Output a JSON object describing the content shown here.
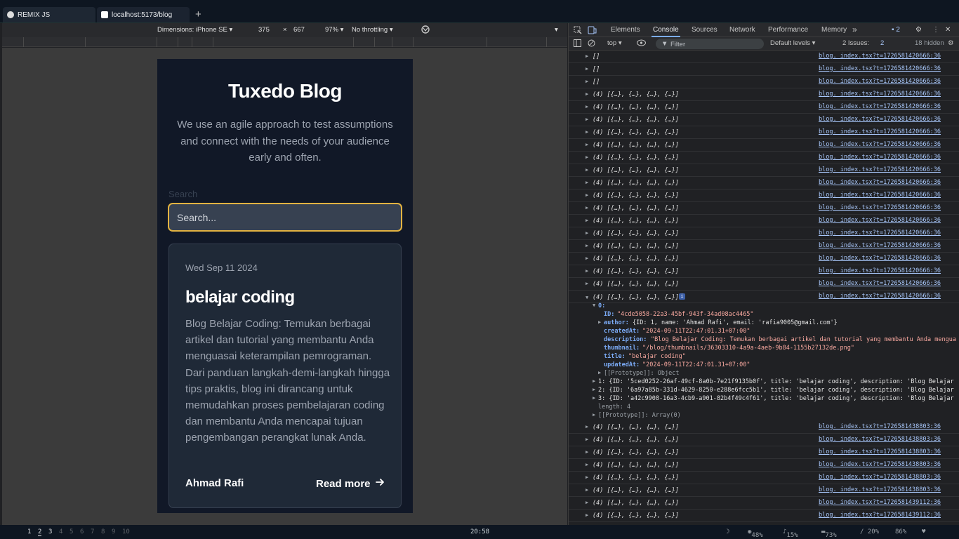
{
  "browser": {
    "tabs": [
      {
        "label": "REMIX JS"
      },
      {
        "label": "localhost:5173/blog"
      }
    ],
    "new_tab": "+"
  },
  "device_toolbar": {
    "dimensions_label": "Dimensions: iPhone SE ▾",
    "width": "375",
    "times": "×",
    "height": "667",
    "zoom": "97% ▾",
    "throttling": "No throttling ▾"
  },
  "blog": {
    "title": "Tuxedo Blog",
    "subtitle": "We use an agile approach to test assumptions and connect with the needs of your audience early and often.",
    "search_label": "Search",
    "search_placeholder": "Search...",
    "post": {
      "date": "Wed Sep 11 2024",
      "title": "belajar coding",
      "description": "Blog Belajar Coding: Temukan berbagai artikel dan tutorial yang membantu Anda menguasai keterampilan pemrograman. Dari panduan langkah-demi-langkah hingga tips praktis, blog ini dirancang untuk memudahkan proses pembelajaran coding dan membantu Anda mencapai tujuan pengembangan perangkat lunak Anda.",
      "author": "Ahmad Rafi",
      "read_more": "Read more"
    }
  },
  "devtools": {
    "tabs": [
      "Elements",
      "Console",
      "Sources",
      "Network",
      "Performance",
      "Memory"
    ],
    "more_tabs": "»",
    "issues_badge": "2",
    "context": "top ▾",
    "filter_placeholder": "Filter",
    "levels": "Default levels ▾",
    "issues_label": "2 Issues:",
    "issues_count": "2",
    "hidden": "18 hidden",
    "rows_top": [
      {
        "msg": "[]",
        "src": "blog._index.tsx?t=1726581420666:36"
      },
      {
        "msg": "[]",
        "src": "blog._index.tsx?t=1726581420666:36"
      },
      {
        "msg": "[]",
        "src": "blog._index.tsx?t=1726581420666:36"
      },
      {
        "msg": "(4) [{…}, {…}, {…}, {…}]",
        "src": "blog._index.tsx?t=1726581420666:36"
      },
      {
        "msg": "(4) [{…}, {…}, {…}, {…}]",
        "src": "blog._index.tsx?t=1726581420666:36"
      },
      {
        "msg": "(4) [{…}, {…}, {…}, {…}]",
        "src": "blog._index.tsx?t=1726581420666:36"
      },
      {
        "msg": "(4) [{…}, {…}, {…}, {…}]",
        "src": "blog._index.tsx?t=1726581420666:36"
      },
      {
        "msg": "(4) [{…}, {…}, {…}, {…}]",
        "src": "blog._index.tsx?t=1726581420666:36"
      },
      {
        "msg": "(4) [{…}, {…}, {…}, {…}]",
        "src": "blog._index.tsx?t=1726581420666:36"
      },
      {
        "msg": "(4) [{…}, {…}, {…}, {…}]",
        "src": "blog._index.tsx?t=1726581420666:36"
      },
      {
        "msg": "(4) [{…}, {…}, {…}, {…}]",
        "src": "blog._index.tsx?t=1726581420666:36"
      },
      {
        "msg": "(4) [{…}, {…}, {…}, {…}]",
        "src": "blog._index.tsx?t=1726581420666:36"
      },
      {
        "msg": "(4) [{…}, {…}, {…}, {…}]",
        "src": "blog._index.tsx?t=1726581420666:36"
      },
      {
        "msg": "(4) [{…}, {…}, {…}, {…}]",
        "src": "blog._index.tsx?t=1726581420666:36"
      },
      {
        "msg": "(4) [{…}, {…}, {…}, {…}]",
        "src": "blog._index.tsx?t=1726581420666:36"
      },
      {
        "msg": "(4) [{…}, {…}, {…}, {…}]",
        "src": "blog._index.tsx?t=1726581420666:36"
      },
      {
        "msg": "(4) [{…}, {…}, {…}, {…}]",
        "src": "blog._index.tsx?t=1726581420666:36"
      },
      {
        "msg": "(4) [{…}, {…}, {…}, {…}]",
        "src": "blog._index.tsx?t=1726581420666:36"
      },
      {
        "msg": "(4) [{…}, {…}, {…}, {…}]",
        "src": "blog._index.tsx?t=1726581420666:36"
      },
      {
        "msg": "",
        "src": "blog._index.tsx?t=1726581420666:36"
      }
    ],
    "expanded": {
      "header": "(4) [{…}, {…}, {…}, {…}]",
      "index0": "0:",
      "id_key": "ID:",
      "id_val": "\"4cde5058-22a3-45bf-943f-34ad08ac4465\"",
      "author_key": "author:",
      "author_val": "{ID: 1, name: 'Ahmad Rafi', email: 'rafia9005@gmail.com'}",
      "created_key": "createdAt:",
      "created_val": "\"2024-09-11T22:47:01.31+07:00\"",
      "desc_key": "description:",
      "desc_val": "\"Blog Belajar Coding: Temukan berbagai artikel dan tutorial yang membantu Anda mengua",
      "thumb_key": "thumbnail:",
      "thumb_val": "\"/blog/thumbnails/36303310-4a9a-4aeb-9b84-1155b27132de.png\"",
      "title_key": "title:",
      "title_val": "\"belajar coding\"",
      "updated_key": "updatedAt:",
      "updated_val": "\"2024-09-11T22:47:01.31+07:00\"",
      "proto_obj": "[[Prototype]]: Object",
      "item1": "1: {ID: '5ced0252-26af-49cf-8a0b-7e21f9135b0f', title: 'belajar coding', description: 'Blog Belajar",
      "item2": "2: {ID: '6a97a85b-331d-4629-8250-e288e6fcc5b1', title: 'belajar coding', description: 'Blog Belajar",
      "item3": "3: {ID: 'a42c9908-16a3-4cb9-a901-82b4f49c4f61', title: 'belajar coding', description: 'Blog Belajar",
      "length": "length: 4",
      "proto_arr": "[[Prototype]]: Array(0)"
    },
    "rows_bottom": [
      {
        "msg": "(4) [{…}, {…}, {…}, {…}]",
        "src": "blog._index.tsx?t=1726581438803:36"
      },
      {
        "msg": "(4) [{…}, {…}, {…}, {…}]",
        "src": "blog._index.tsx?t=1726581438803:36"
      },
      {
        "msg": "(4) [{…}, {…}, {…}, {…}]",
        "src": "blog._index.tsx?t=1726581438803:36"
      },
      {
        "msg": "(4) [{…}, {…}, {…}, {…}]",
        "src": "blog._index.tsx?t=1726581438803:36"
      },
      {
        "msg": "(4) [{…}, {…}, {…}, {…}]",
        "src": "blog._index.tsx?t=1726581438803:36"
      },
      {
        "msg": "(4) [{…}, {…}, {…}, {…}]",
        "src": "blog._index.tsx?t=1726581438803:36"
      },
      {
        "msg": "(4) [{…}, {…}, {…}, {…}]",
        "src": "blog._index.tsx?t=1726581439112:36"
      },
      {
        "msg": "(4) [{…}, {…}, {…}, {…}]",
        "src": "blog._index.tsx?t=1726581439112:36"
      }
    ]
  },
  "statusbar": {
    "workspaces": [
      "1",
      "2",
      "3",
      "4",
      "5",
      "6",
      "7",
      "8",
      "9",
      "10"
    ],
    "clock": "20:58",
    "battery": "48%",
    "volume": "15%",
    "memory": "73%",
    "disk": "/ 20%",
    "cpu": "86%"
  }
}
